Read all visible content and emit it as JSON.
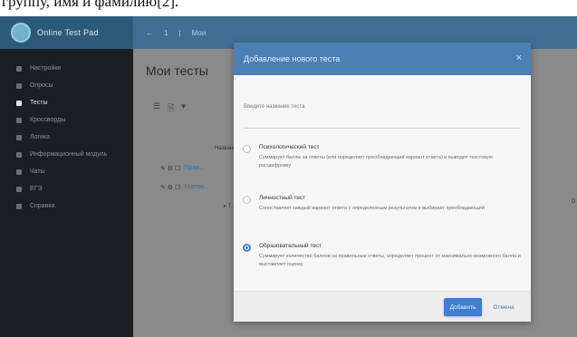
{
  "caption": {
    "text": "группу, имя и фамилию[2]."
  },
  "sidebar": {
    "brand": "Online Test Pad",
    "items": [
      {
        "label": "Настройки",
        "active": false
      },
      {
        "label": "Опросы",
        "active": false
      },
      {
        "label": "Тесты",
        "active": true
      },
      {
        "label": "Кроссворды",
        "active": false
      },
      {
        "label": "Логика",
        "active": false
      },
      {
        "label": "Информационный модуль",
        "active": false
      },
      {
        "label": "Чаты",
        "active": false
      },
      {
        "label": "ЕГЭ",
        "active": false
      },
      {
        "label": "Справка",
        "active": false
      }
    ]
  },
  "topbar": {
    "items": [
      "←",
      "1",
      "|",
      "Мои"
    ]
  },
  "main": {
    "page_title": "Мои тесты",
    "toolbar": [
      "☰",
      "🗎",
      "▾"
    ],
    "column_header": "Название",
    "rows": [
      {
        "icons": "✎ ⚙ ☐",
        "label": "Прав..."
      },
      {
        "icons": "✎ ⚙ ☐",
        "label": "Матем..."
      }
    ],
    "row_sub": "▸ Т...",
    "right_digit": "0"
  },
  "modal": {
    "title": "Добавление нового теста",
    "close": "×",
    "name_label": "Введите название теста",
    "name_value": "",
    "options": [
      {
        "title": "Психологический тест",
        "desc": "Суммирует баллы за ответы (или определяет преобладающий вариант ответа) и выводит текстовую расшифровку",
        "checked": false
      },
      {
        "title": "Личностный тест",
        "desc": "Сопоставляет каждый вариант ответа с определенным результатом и выбирает преобладающий",
        "checked": false
      },
      {
        "title": "Образовательный тест",
        "desc": "Суммирует количество баллов за правильные ответы, определяет процент от максимально возможного балла и выставляет оценку",
        "checked": true
      }
    ],
    "add_button": "Добавить",
    "cancel_button": "Отмена"
  },
  "colors": {
    "sidebar": "#1c1f22",
    "topbar": "#3f6f93",
    "modal_header": "#4c7fb6",
    "accent": "#3f7fd1"
  }
}
